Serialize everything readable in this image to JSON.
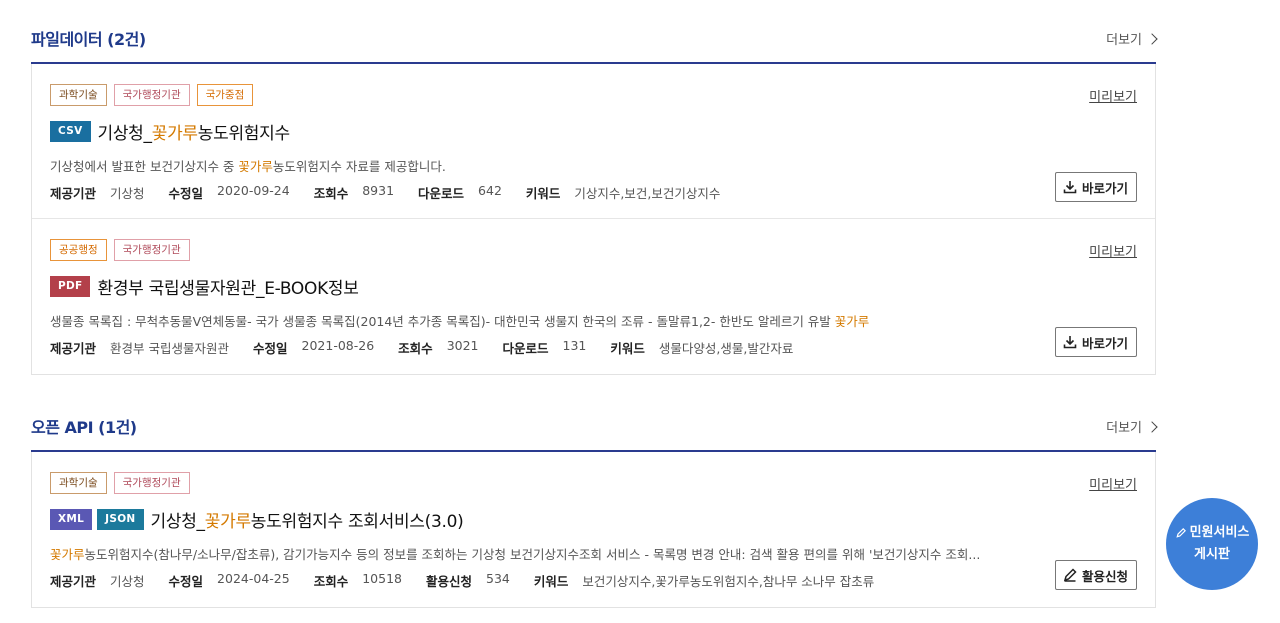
{
  "file_section": {
    "title": "파일데이터 (2건)",
    "more_label": "더보기",
    "cards": [
      {
        "tags": [
          "과학기술",
          "국가행정기관",
          "국가중점"
        ],
        "format": "CSV",
        "title_pre": "기상청_",
        "title_hl": "꽃가루",
        "title_post": "농도위험지수",
        "desc_pre": "기상청에서 발표한 보건기상지수 중 ",
        "desc_hl": "꽃가루",
        "desc_post": "농도위험지수 자료를 제공합니다.",
        "preview_label": "미리보기",
        "meta": [
          {
            "k": "제공기관",
            "v": "기상청"
          },
          {
            "k": "수정일",
            "v": "2020-09-24"
          },
          {
            "k": "조회수",
            "v": "8931"
          },
          {
            "k": "다운로드",
            "v": "642"
          },
          {
            "k": "키워드",
            "v": "기상지수,보건,보건기상지수"
          }
        ],
        "button_label": "바로가기"
      },
      {
        "tags": [
          "공공행정",
          "국가행정기관"
        ],
        "format": "PDF",
        "title_pre": "환경부 국립생물자원관_E-BOOK정보",
        "title_hl": "",
        "title_post": "",
        "desc_pre": "생물종 목록집 : 무척추동물V연체동물- 국가 생물종 목록집(2014년 추가종 목록집)- 대한민국 생물지 한국의 조류 - 돌말류1,2- 한반도 알레르기 유발 ",
        "desc_hl": "꽃가루",
        "desc_post": "",
        "preview_label": "미리보기",
        "meta": [
          {
            "k": "제공기관",
            "v": "환경부 국립생물자원관"
          },
          {
            "k": "수정일",
            "v": "2021-08-26"
          },
          {
            "k": "조회수",
            "v": "3021"
          },
          {
            "k": "다운로드",
            "v": "131"
          },
          {
            "k": "키워드",
            "v": "생물다양성,생물,발간자료"
          }
        ],
        "button_label": "바로가기"
      }
    ]
  },
  "api_section": {
    "title": "오픈 API (1건)",
    "more_label": "더보기",
    "cards": [
      {
        "tags": [
          "과학기술",
          "국가행정기관"
        ],
        "formats": [
          "XML",
          "JSON"
        ],
        "title_pre": "기상청_",
        "title_hl": "꽃가루",
        "title_post": "농도위험지수 조회서비스(3.0)",
        "desc_pre": "",
        "desc_hl": "꽃가루",
        "desc_post": "농도위험지수(참나무/소나무/잡초류), 감기가능지수 등의 정보를 조회하는 기상청 보건기상지수조회 서비스 - 목록명 변경 안내: 검색 활용 편의를 위해 '보건기상지수 조회...",
        "preview_label": "미리보기",
        "meta": [
          {
            "k": "제공기관",
            "v": "기상청"
          },
          {
            "k": "수정일",
            "v": "2024-04-25"
          },
          {
            "k": "조회수",
            "v": "10518"
          },
          {
            "k": "활용신청",
            "v": "534"
          },
          {
            "k": "키워드",
            "v": "보건기상지수,꽃가루농도위험지수,참나무 소나무 잡초류"
          }
        ],
        "button_label": "활용신청"
      }
    ]
  },
  "float_button": {
    "line1": "민원서비스",
    "line2": "게시판"
  },
  "colors": {
    "accent": "#1f3a8a",
    "highlight": "#d47a00",
    "float_bg": "#3d7fd8"
  }
}
